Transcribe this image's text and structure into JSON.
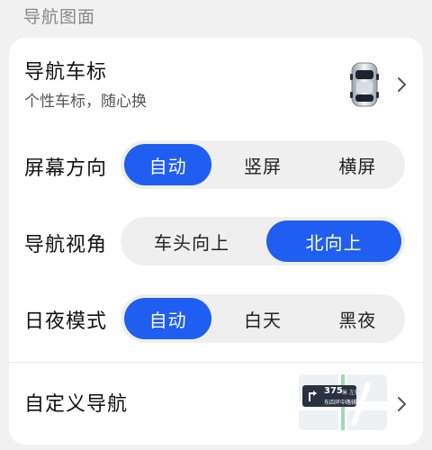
{
  "section": {
    "title": "导航图面"
  },
  "vehicle_icon": {
    "title": "导航车标",
    "subtitle": "个性车标，随心换"
  },
  "screen_orientation": {
    "label": "屏幕方向",
    "options": [
      "自动",
      "竖屏",
      "横屏"
    ],
    "selected": "自动"
  },
  "nav_view": {
    "label": "导航视角",
    "options": [
      "车头向上",
      "北向上"
    ],
    "selected": "北向上"
  },
  "day_night": {
    "label": "日夜模式",
    "options": [
      "自动",
      "白天",
      "黑夜"
    ],
    "selected": "自动"
  },
  "custom_nav": {
    "label": "自定义导航",
    "preview": {
      "distance": "375",
      "unit": "米",
      "turn_text": "左转",
      "road": "东四环中路辅路"
    }
  },
  "colors": {
    "accent": "#1f5ef0",
    "segment_bg": "#efefef",
    "page_bg": "#f1f1f1"
  }
}
